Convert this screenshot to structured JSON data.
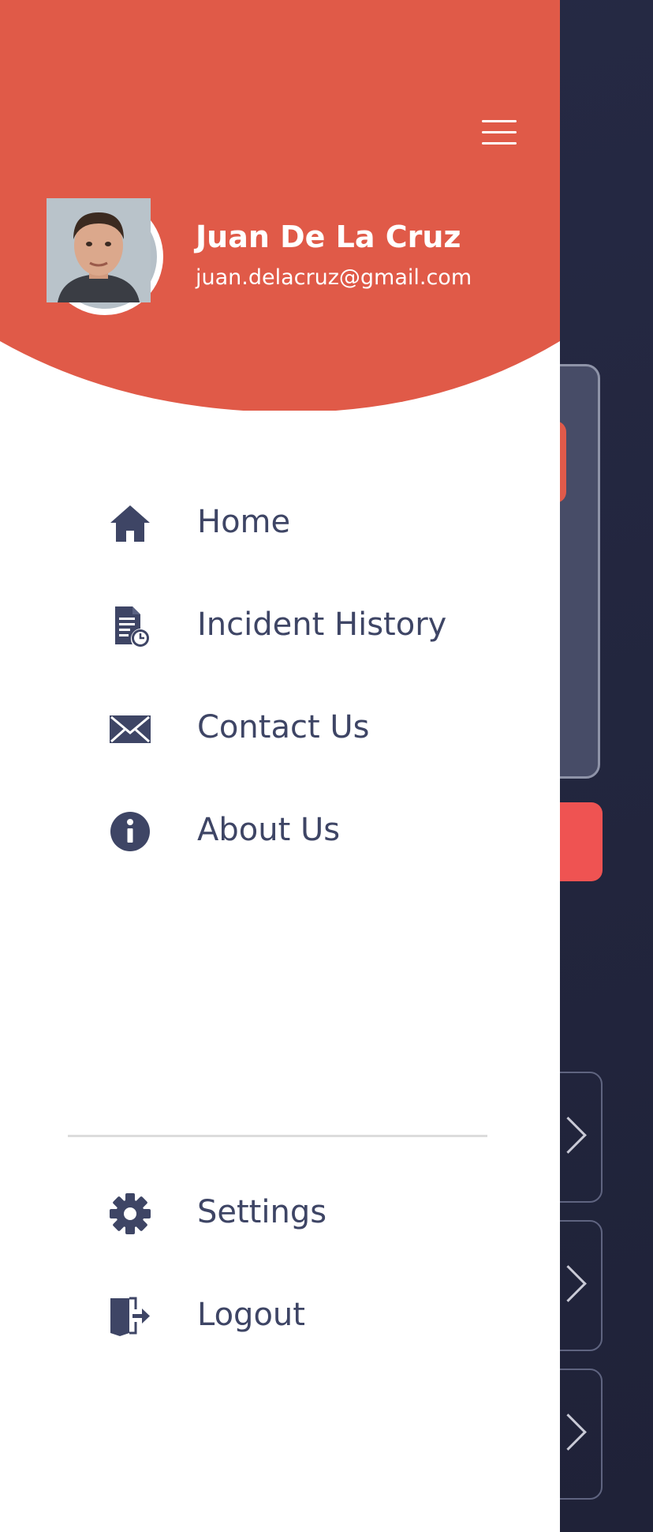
{
  "profile": {
    "name": "Juan De La Cruz",
    "email": "juan.delacruz@gmail.com",
    "avatar_alt": "user avatar"
  },
  "menu": {
    "items": [
      {
        "label": "Home",
        "icon": "home-icon"
      },
      {
        "label": "Incident History",
        "icon": "document-history-icon"
      },
      {
        "label": "Contact Us",
        "icon": "envelope-icon"
      },
      {
        "label": "About Us",
        "icon": "info-icon"
      }
    ],
    "bottom_items": [
      {
        "label": "Settings",
        "icon": "gear-icon"
      },
      {
        "label": "Logout",
        "icon": "logout-icon"
      }
    ]
  },
  "colors": {
    "header": "#e05a48",
    "menu_text": "#3e4565",
    "background_app": "#22253d",
    "accent_red": "#ef5352"
  }
}
